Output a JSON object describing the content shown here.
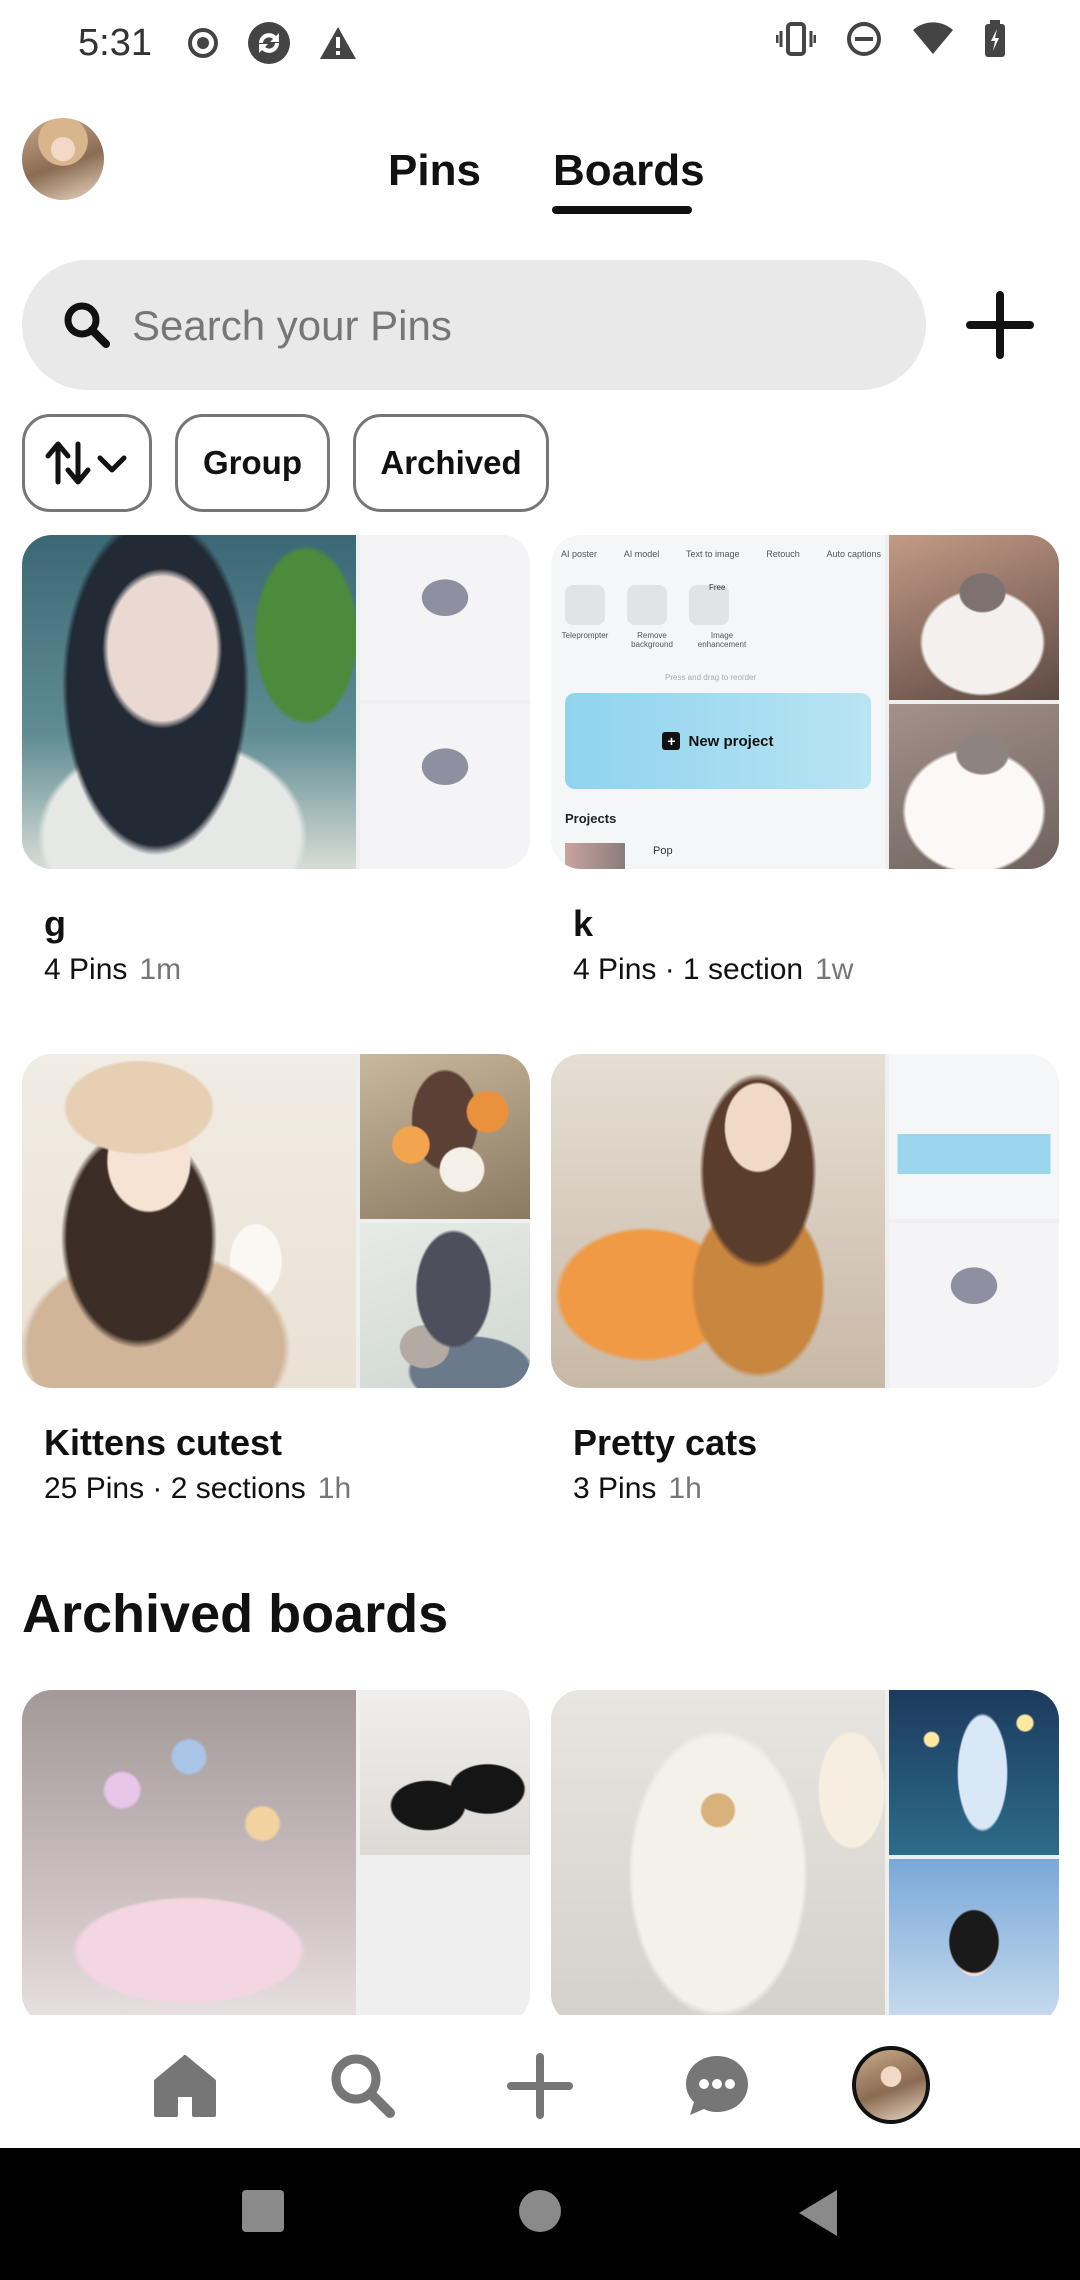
{
  "status_bar": {
    "time": "5:31",
    "left_icons": [
      "record-icon",
      "sync-icon",
      "alert-icon"
    ],
    "right_icons": [
      "vibrate-icon",
      "dnd-icon",
      "wifi-icon",
      "battery-icon"
    ]
  },
  "header": {
    "tabs": [
      {
        "label": "Pins",
        "active": false
      },
      {
        "label": "Boards",
        "active": true
      }
    ]
  },
  "search": {
    "placeholder": "Search your Pins"
  },
  "filters": {
    "sort_icon": "sort-arrows-icon",
    "group_label": "Group",
    "archived_label": "Archived"
  },
  "boards": [
    {
      "title": "g",
      "meta": "4 Pins",
      "time": "1m"
    },
    {
      "title": "k",
      "meta": "4 Pins · 1 section",
      "time": "1w"
    },
    {
      "title": "Kittens cutest",
      "meta": "25 Pins · 2 sections",
      "time": "1h"
    },
    {
      "title": "Pretty cats",
      "meta": "3 Pins",
      "time": "1h"
    }
  ],
  "board_k_thumb": {
    "toolbar_items": [
      "AI poster",
      "AI model",
      "Text to image",
      "Retouch",
      "Auto captions"
    ],
    "tool_labels": [
      "Teleprompter",
      "Remove background",
      "Image enhancement"
    ],
    "badge": "Free",
    "hint": "Press and drag to reorder",
    "new_project": "New project",
    "projects": "Projects",
    "pop": "Pop"
  },
  "archived": {
    "heading": "Archived boards"
  },
  "bottom_nav": {
    "items": [
      "home-icon",
      "search-icon",
      "create-icon",
      "messages-icon",
      "profile-avatar"
    ]
  },
  "colors": {
    "text": "#111111",
    "muted": "#767676",
    "search_bg": "#e9e9e9"
  }
}
